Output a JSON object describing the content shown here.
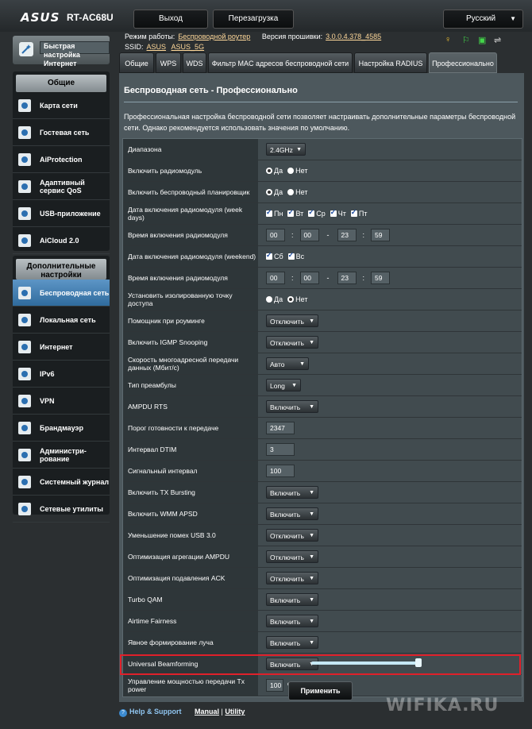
{
  "header": {
    "logo": "ASUS",
    "model": "RT-AC68U",
    "logout": "Выход",
    "reboot": "Перезагрузка",
    "language": "Русский",
    "mode_label": "Режим работы:",
    "mode_value": "Беспроводной роутер",
    "firmware_label": "Версия прошивки:",
    "firmware_value": "3.0.0.4.378_4585",
    "ssid_label": "SSID:",
    "ssid_1": "ASUS",
    "ssid_2": "ASUS_5G"
  },
  "sidebar": {
    "quick_setup": "Быстрая настройка Интернет",
    "general_title": "Общие",
    "general": [
      {
        "label": "Карта сети",
        "icon": "network-map-icon"
      },
      {
        "label": "Гостевая сеть",
        "icon": "guest-network-icon"
      },
      {
        "label": "AiProtection",
        "icon": "lock-icon"
      },
      {
        "label": "Адаптивный сервис QoS",
        "icon": "gauge-icon"
      },
      {
        "label": "USB-приложение",
        "icon": "usb-icon"
      },
      {
        "label": "AiCloud 2.0",
        "icon": "cloud-icon"
      }
    ],
    "advanced_title": "Дополнительные настройки",
    "advanced": [
      {
        "label": "Беспроводная сеть",
        "icon": "wifi-icon"
      },
      {
        "label": "Локальная сеть",
        "icon": "home-icon"
      },
      {
        "label": "Интернет",
        "icon": "globe-icon"
      },
      {
        "label": "IPv6",
        "icon": "ipv6-icon"
      },
      {
        "label": "VPN",
        "icon": "vpn-icon"
      },
      {
        "label": "Брандмауэр",
        "icon": "firewall-icon"
      },
      {
        "label": "Администри-рование",
        "icon": "admin-icon"
      },
      {
        "label": "Системный журнал",
        "icon": "log-icon"
      },
      {
        "label": "Сетевые утилиты",
        "icon": "tools-icon"
      }
    ]
  },
  "tabs": [
    "Общие",
    "WPS",
    "WDS",
    "Фильтр MAC адресов беспроводной сети",
    "Настройка RADIUS",
    "Профессионально"
  ],
  "main": {
    "title": "Беспроводная сеть - Профессионально",
    "description": "Профессиональная настройка беспроводной сети позволяет настраивать дополнительные параметры беспроводной сети. Однако рекомендуется использовать значения по умолчанию.",
    "yes": "Да",
    "no": "Нет",
    "weekdays": [
      "Пн",
      "Вт",
      "Ср",
      "Чт",
      "Пт"
    ],
    "weekend": [
      "Сб",
      "Вс"
    ],
    "time1": [
      "00",
      "00",
      "23",
      "59"
    ],
    "time2": [
      "00",
      "00",
      "23",
      "59"
    ],
    "rows": [
      {
        "label": "Диапазона",
        "value": "2.4GHz"
      },
      {
        "label": "Включить радиомодуль",
        "value": ""
      },
      {
        "label": "Включить беспроводный планировщик",
        "value": ""
      },
      {
        "label": "Дата включения радиомодуля (week days)",
        "value": ""
      },
      {
        "label": "Время включения радиомодуля",
        "value": ""
      },
      {
        "label": "Дата включения радиомодуля (weekend)",
        "value": ""
      },
      {
        "label": "Время включения радиомодуля",
        "value": ""
      },
      {
        "label": "Установить изолированную точку доступа",
        "value": ""
      },
      {
        "label": "Помощник при роуминге",
        "value": "Отключить"
      },
      {
        "label": "Включить IGMP Snooping",
        "value": "Отключить"
      },
      {
        "label": "Скорость многоадресной передачи данных (Мбит/с)",
        "value": "Авто"
      },
      {
        "label": "Тип преамбулы",
        "value": "Long"
      },
      {
        "label": "AMPDU RTS",
        "value": "Включить"
      },
      {
        "label": "Порог готовности к передаче",
        "value": "2347"
      },
      {
        "label": "Интервал DTIM",
        "value": "3"
      },
      {
        "label": "Сигнальный интервал",
        "value": "100"
      },
      {
        "label": "Включить TX Bursting",
        "value": "Включить"
      },
      {
        "label": "Включить WMM APSD",
        "value": "Включить"
      },
      {
        "label": "Уменьшение помех USB 3.0",
        "value": "Отключить"
      },
      {
        "label": "Оптимизация агрегации AMPDU",
        "value": "Отключить"
      },
      {
        "label": "Оптимизация подавления ACK",
        "value": "Отключить"
      },
      {
        "label": "Turbo QAM",
        "value": "Включить"
      },
      {
        "label": "Airtime Fairness",
        "value": "Включить"
      },
      {
        "label": "Явное формирование луча",
        "value": "Включить"
      },
      {
        "label": "Universal Beamforming",
        "value": "Включить"
      },
      {
        "label": "Управление мощностью передачи Tx power",
        "value": "100"
      }
    ],
    "percent": "%",
    "tx_power_percent": 100,
    "apply": "Применить"
  },
  "footer": {
    "help": "Help & Support",
    "manual": "Manual",
    "separator": "|",
    "utility": "Utility"
  },
  "watermark": "WIFIKA.RU"
}
